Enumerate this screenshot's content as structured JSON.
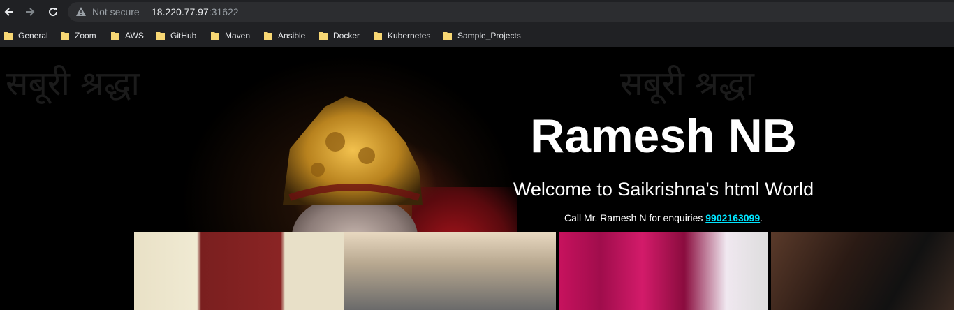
{
  "browser": {
    "security_label": "Not secure",
    "url_host": "18.220.77.97",
    "url_port": ":31622",
    "bookmarks": [
      "General",
      "Zoom",
      "AWS",
      "GitHub",
      "Maven",
      "Ansible",
      "Docker",
      "Kubernetes",
      "Sample_Projects"
    ]
  },
  "page": {
    "title": "Ramesh NB",
    "subtitle": "Welcome to Saikrishna's html World",
    "contact_prefix": "Call Mr. Ramesh N for enquiries ",
    "phone": "9902163099",
    "contact_suffix": ".",
    "background_text": "सबूरी श्रद्धा"
  },
  "colors": {
    "chrome_bg": "#202124",
    "omnibox_bg": "#2c2d30",
    "folder": "#f7d774",
    "link": "#00e5ff"
  }
}
